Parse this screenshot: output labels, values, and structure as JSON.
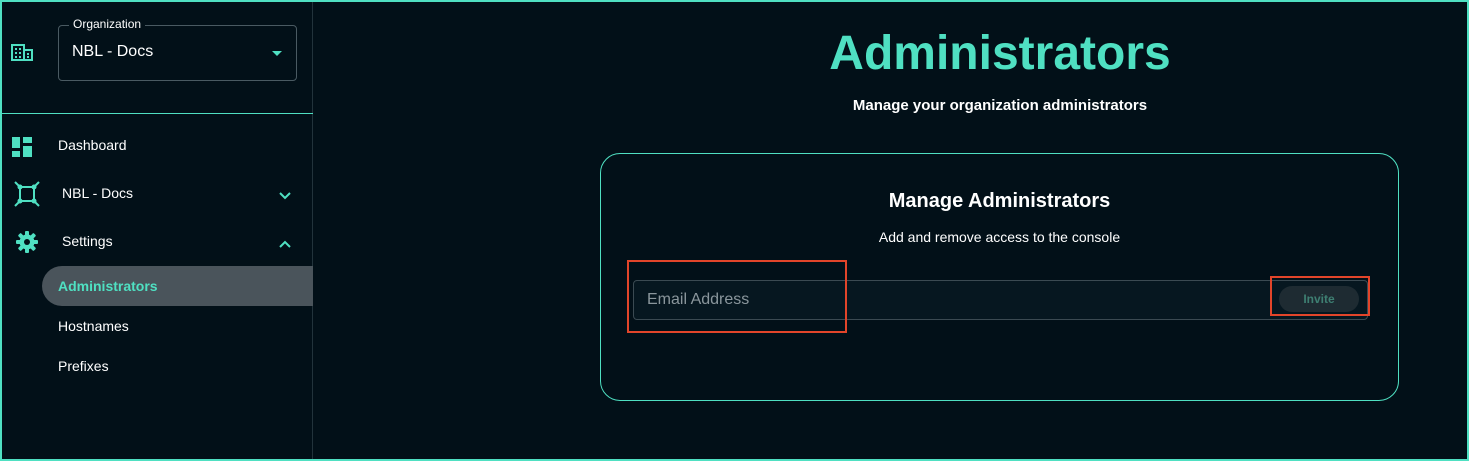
{
  "sidebar": {
    "organization": {
      "legend": "Organization",
      "value": "NBL - Docs"
    },
    "nav": [
      {
        "label": "Dashboard",
        "icon": "dashboard-icon"
      },
      {
        "label": "NBL - Docs",
        "icon": "network-icon",
        "chevron": "chevron-down-icon"
      },
      {
        "label": "Settings",
        "icon": "gear-icon",
        "chevron": "chevron-up-icon"
      }
    ],
    "settings_items": [
      {
        "label": "Administrators",
        "active": true
      },
      {
        "label": "Hostnames"
      },
      {
        "label": "Prefixes"
      }
    ]
  },
  "main": {
    "title": "Administrators",
    "subtitle": "Manage your organization administrators",
    "card": {
      "title": "Manage Administrators",
      "subtitle": "Add and remove access to the console",
      "email_placeholder": "Email Address",
      "email_value": "",
      "invite_label": "Invite"
    }
  },
  "colors": {
    "background": "#021018",
    "accent": "#4fe0c2",
    "highlight": "#e2452a",
    "active_item_bg": "#4a545b"
  }
}
